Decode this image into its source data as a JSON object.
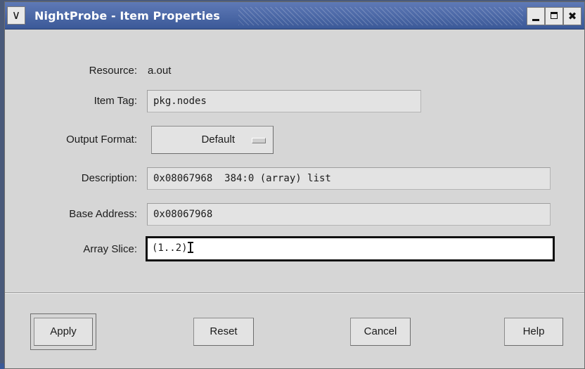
{
  "window": {
    "title": "NightProbe - Item Properties",
    "menu_icon": "chevron-down-icon",
    "controls": [
      "minimize-icon",
      "maximize-icon",
      "close-icon"
    ]
  },
  "form": {
    "resource": {
      "label": "Resource:",
      "value": "a.out"
    },
    "item_tag": {
      "label": "Item Tag:",
      "value": "pkg.nodes"
    },
    "output_format": {
      "label": "Output Format:",
      "value": "Default"
    },
    "description": {
      "label": "Description:",
      "value": "0x08067968  384:0 (array) list"
    },
    "base_address": {
      "label": "Base Address:",
      "value": "0x08067968"
    },
    "array_slice": {
      "label": "Array Slice:",
      "value": "(1..2)"
    }
  },
  "buttons": {
    "apply": "Apply",
    "reset": "Reset",
    "cancel": "Cancel",
    "help": "Help"
  }
}
